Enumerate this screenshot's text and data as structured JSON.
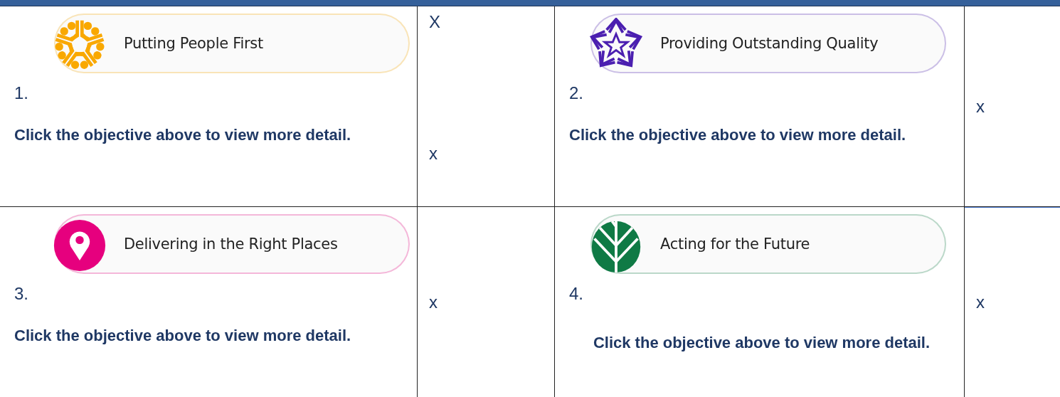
{
  "rows": [
    {
      "cells": [
        {
          "objective": {
            "label": "Putting People First",
            "kind": "people",
            "color": "#f9a800"
          },
          "number": "1.",
          "note": "Click the objective above to view more detail.",
          "centered": false,
          "marks": [
            "X",
            "x"
          ]
        },
        {
          "objective": {
            "label": "Providing Outstanding Quality",
            "kind": "star",
            "color": "#4b1fb0"
          },
          "number": "2.",
          "note": "Click the objective above to view more detail.",
          "centered": false,
          "marks": [
            "x"
          ]
        }
      ]
    },
    {
      "cells": [
        {
          "objective": {
            "label": "Delivering in the Right Places",
            "kind": "pin",
            "color": "#e6007e"
          },
          "number": "3.",
          "note": "Click the objective above to view more detail.",
          "centered": false,
          "marks": [
            "x"
          ]
        },
        {
          "objective": {
            "label": "Acting for the Future",
            "kind": "leaf",
            "color": "#0f7a45"
          },
          "number": "4.",
          "note": "Click the objective above to view more detail.",
          "centered": true,
          "marks": [
            "x"
          ]
        }
      ]
    }
  ]
}
